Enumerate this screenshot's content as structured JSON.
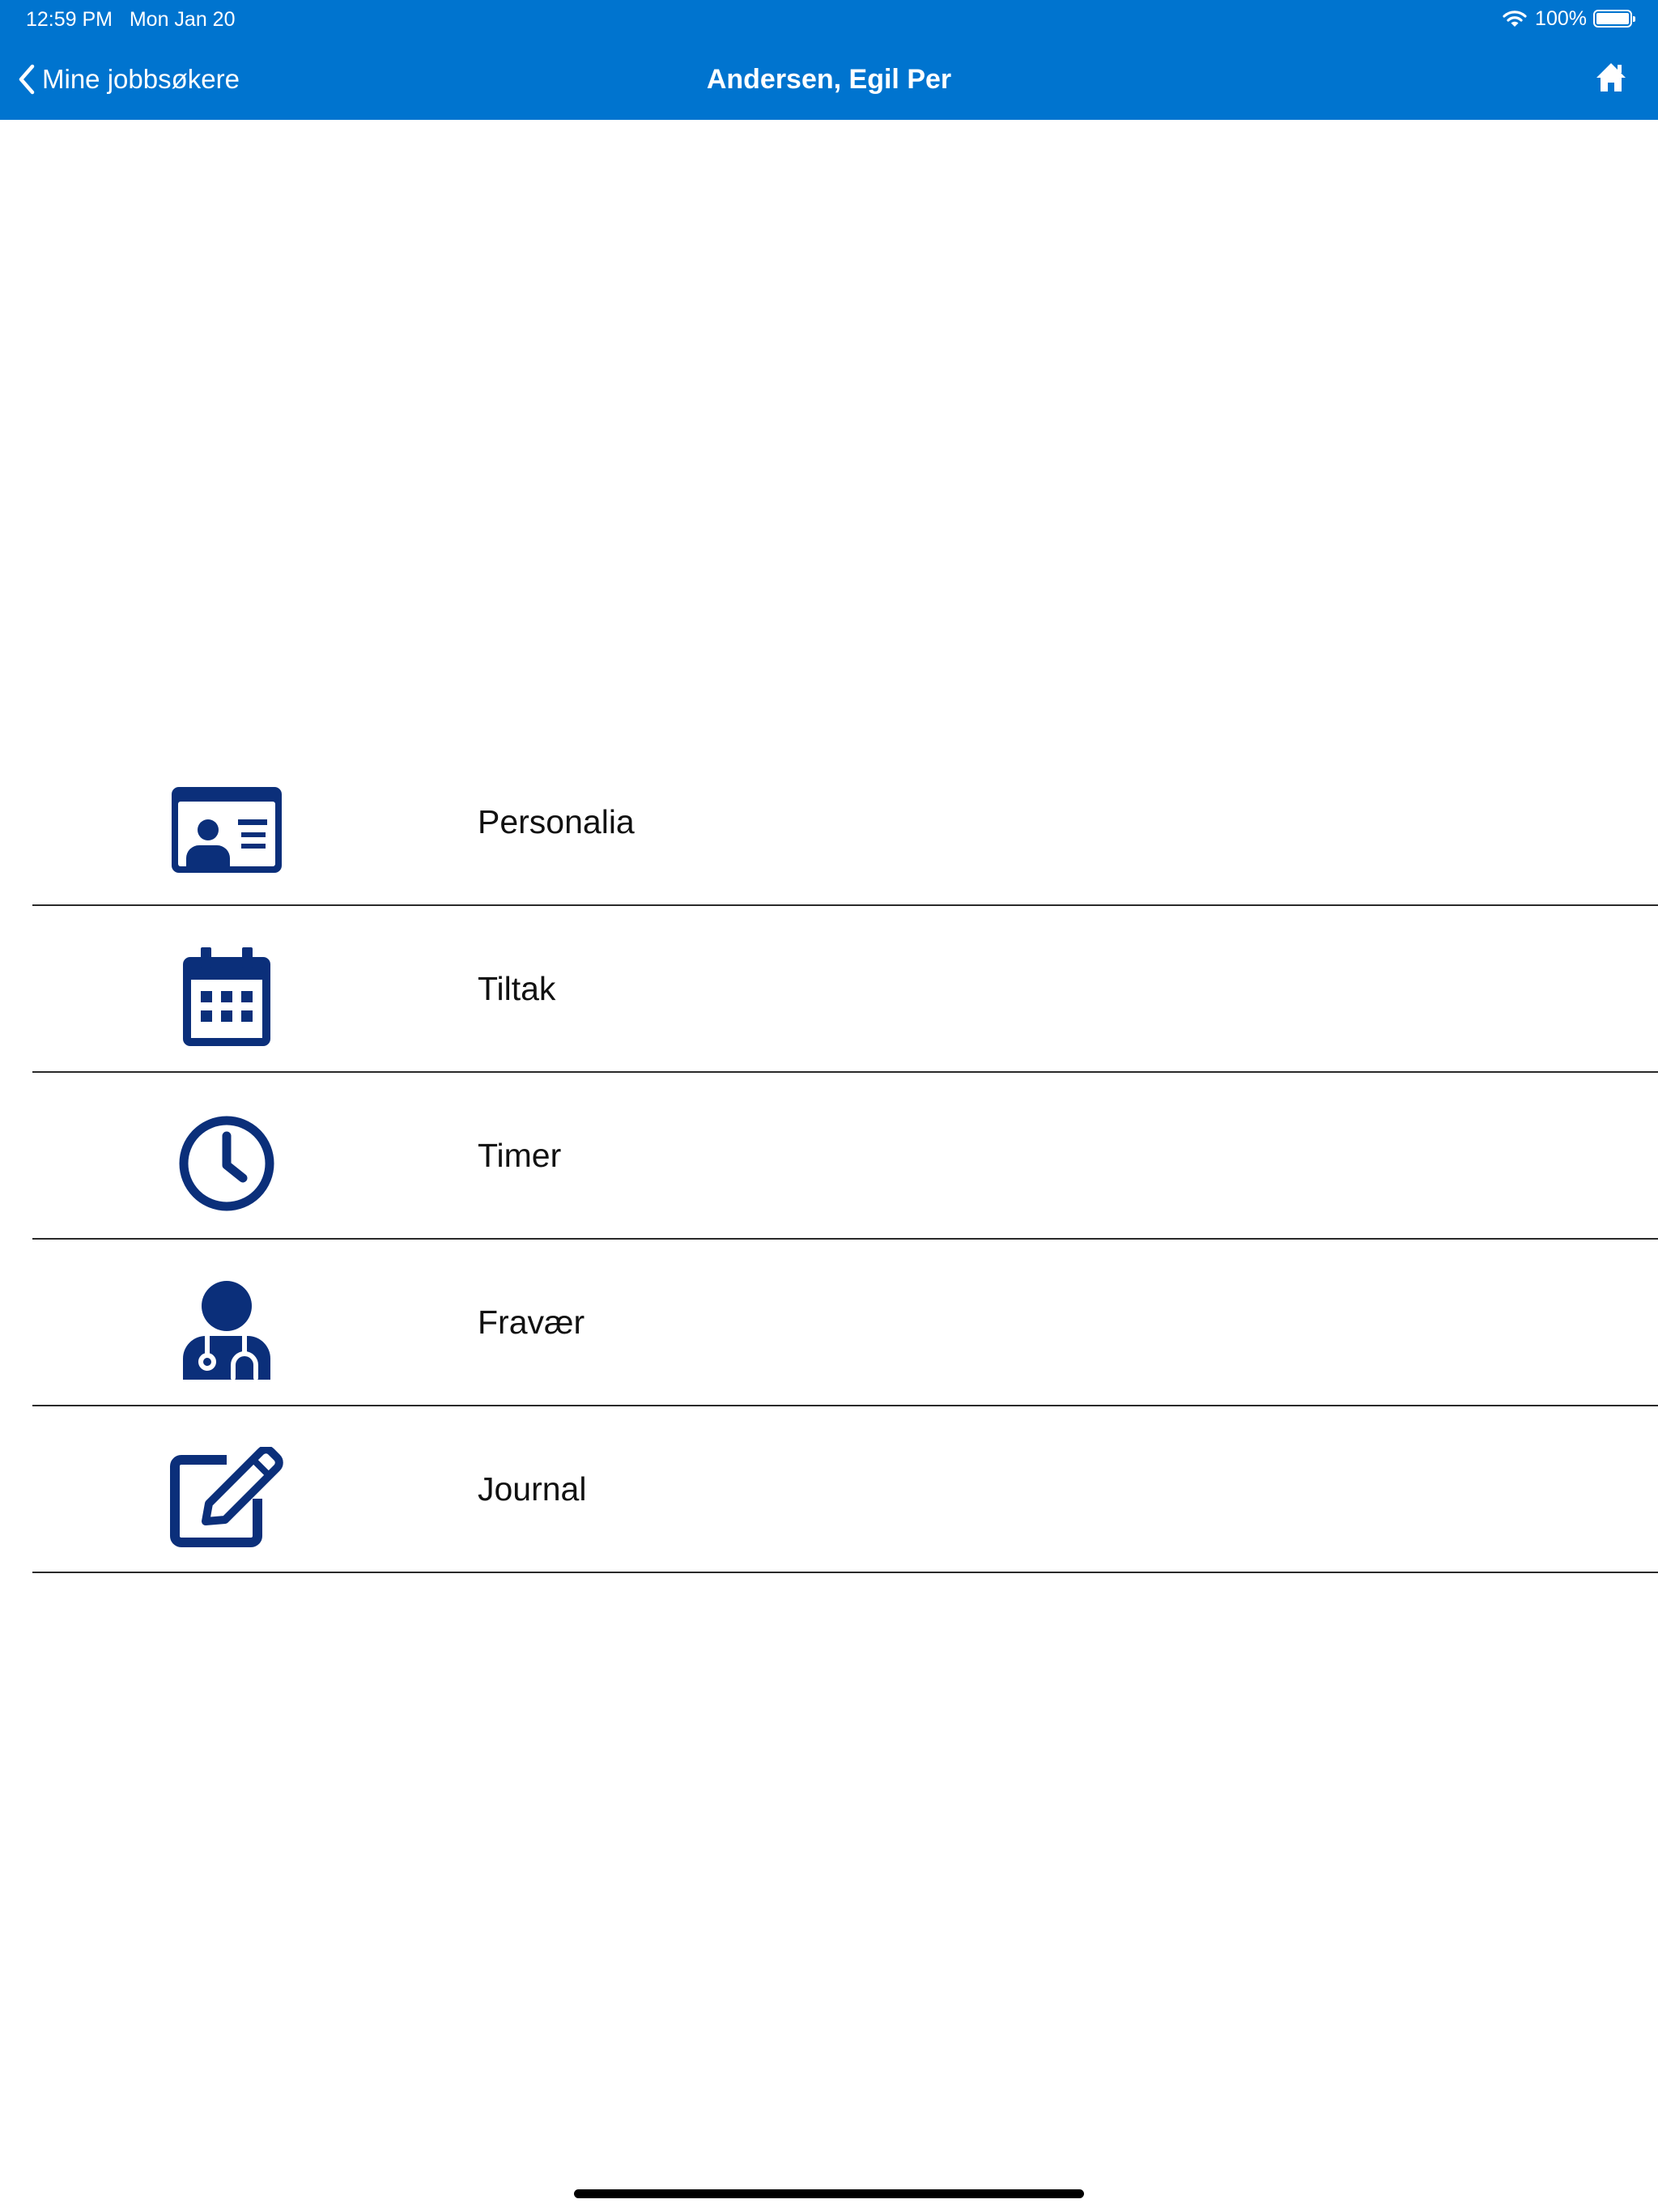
{
  "status_bar": {
    "time": "12:59 PM   Mon Jan 20",
    "battery_percent": "100%",
    "battery_level": 1.0,
    "wifi_icon": "wifi-icon",
    "battery_icon": "battery-icon"
  },
  "nav": {
    "back_label": "Mine jobbsøkere",
    "back_icon": "chevron-left-icon",
    "title": "Andersen, Egil Per",
    "home_icon": "home-icon"
  },
  "menu": [
    {
      "label": "Personalia",
      "icon": "id-card-icon"
    },
    {
      "label": "Tiltak",
      "icon": "calendar-icon"
    },
    {
      "label": "Timer",
      "icon": "clock-icon"
    },
    {
      "label": "Fravær",
      "icon": "doctor-icon"
    },
    {
      "label": "Journal",
      "icon": "edit-icon"
    }
  ],
  "colors": {
    "header_bg": "#0074cf",
    "icon": "#0b2f7a",
    "divider": "#2a2a2a",
    "text": "#111111"
  }
}
